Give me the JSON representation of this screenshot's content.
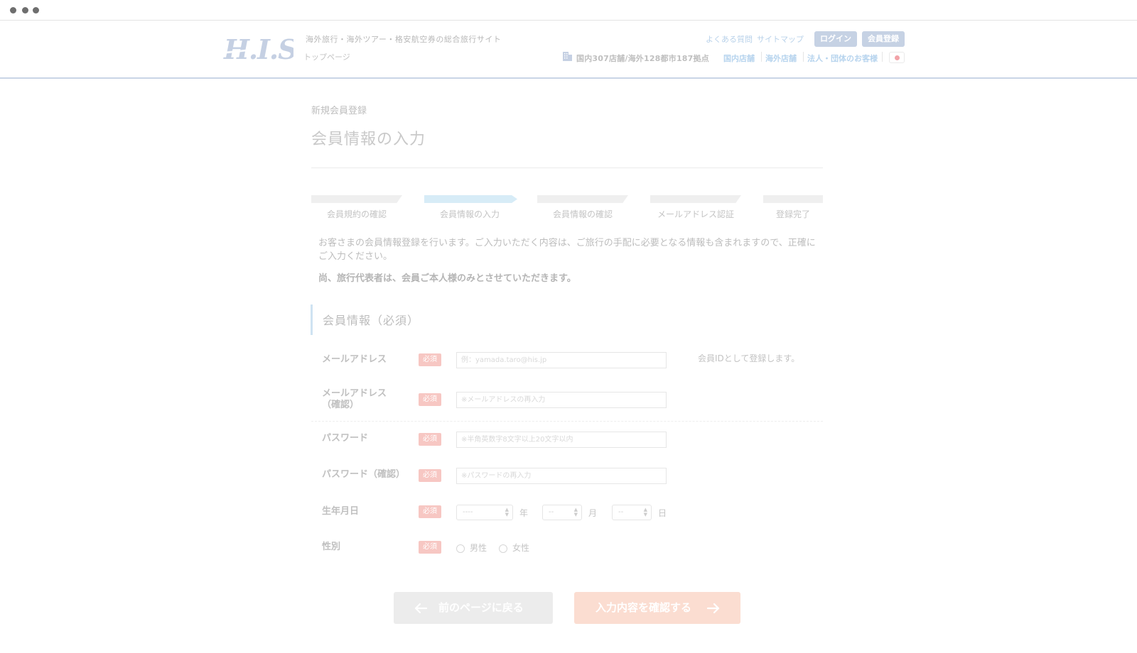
{
  "header": {
    "tagline": "海外旅行・海外ツアー・格安航空券の総合旅行サイト",
    "top_page": "トップページ",
    "faq": "よくある質問",
    "sitemap": "サイトマップ",
    "login": "ログイン",
    "register": "会員登録",
    "stores_count": "国内307店舗/海外128都市187拠点",
    "domestic_stores": "国内店舗",
    "overseas_stores": "海外店舗",
    "corporate": "法人・団体のお客様"
  },
  "page": {
    "breadcrumb": "新規会員登録",
    "title": "会員情報の入力"
  },
  "steps": [
    {
      "label": "会員規約の確認",
      "active": false
    },
    {
      "label": "会員情報の入力",
      "active": true
    },
    {
      "label": "会員情報の確認",
      "active": false
    },
    {
      "label": "メールアドレス認証",
      "active": false
    },
    {
      "label": "登録完了",
      "active": false
    }
  ],
  "intro": {
    "text": "お客さまの会員情報登録を行います。ご入力いただく内容は、ご旅行の手配に必要となる情報も含まれますので、正確にご入力ください。",
    "bold": "尚、旅行代表者は、会員ご本人様のみとさせていただきます。"
  },
  "section": {
    "title": "会員情報（必須）"
  },
  "form": {
    "required_badge": "必須",
    "email_label": "メールアドレス",
    "email_placeholder": "例：yamada.taro@his.jp",
    "email_note": "会員IDとして登録します。",
    "email_confirm_label_1": "メールアドレス",
    "email_confirm_label_2": "（確認）",
    "email_confirm_placeholder": "※メールアドレスの再入力",
    "password_label": "パスワード",
    "password_placeholder": "※半角英数字8文字以上20文字以内",
    "password_confirm_label": "パスワード（確認）",
    "password_confirm_placeholder": "※パスワードの再入力",
    "birthdate_label": "生年月日",
    "year_value": "----",
    "year_unit": "年",
    "month_value": "--",
    "month_unit": "月",
    "day_value": "--",
    "day_unit": "日",
    "gender_label": "性別",
    "male": "男性",
    "female": "女性"
  },
  "buttons": {
    "back": "前のページに戻る",
    "confirm": "入力内容を確認する"
  },
  "colors": {
    "logo": "#c5d0e3",
    "active_step": "#d7ecf7",
    "required_badge": "#f7c7c3",
    "confirm_button": "#fbddd1",
    "back_button": "#ececec"
  }
}
